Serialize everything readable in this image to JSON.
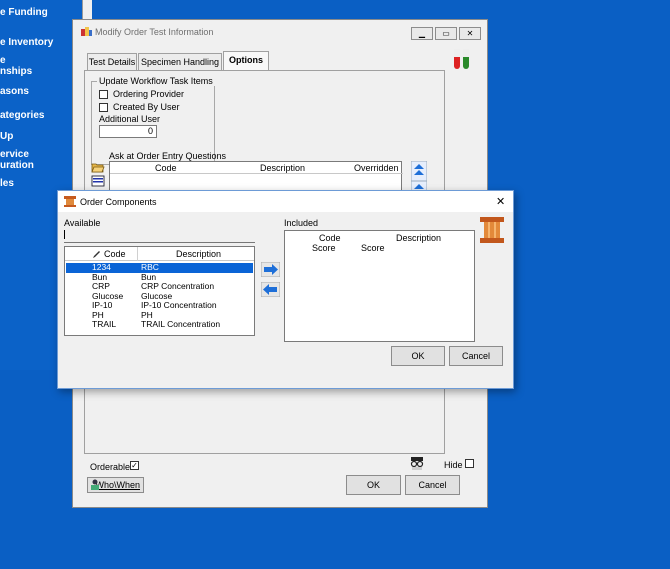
{
  "sidebar": {
    "items": [
      "e Funding",
      "e Inventory",
      "e",
      "nships",
      "asons",
      "ategories",
      "Up",
      "ervice",
      "uration",
      "les"
    ]
  },
  "main_window": {
    "title": "Modify Order Test Information",
    "tabs": [
      "Test Details",
      "Specimen Handling",
      "Options"
    ],
    "workflow_group_title": "Update Workflow Task Items",
    "ordering_provider_label": "Ordering Provider",
    "created_by_user_label": "Created By User",
    "additional_user_label": "Additional User",
    "additional_user_value": "0",
    "aoe_label": "Ask at Order Entry Questions",
    "aoe_columns": [
      "Code",
      "Description",
      "Overridden"
    ],
    "orderable_label": "Orderable",
    "orderable_checked": true,
    "who_when_label": "Who\\When",
    "hide_label": "Hide",
    "ok_label": "OK",
    "cancel_label": "Cancel"
  },
  "dialog": {
    "title": "Order Components",
    "close_glyph": "✕",
    "available_label": "Available",
    "search_value": "",
    "included_label": "Included",
    "available_columns": [
      "Code",
      "Description"
    ],
    "available_rows": [
      {
        "code": "1234",
        "desc": "RBC"
      },
      {
        "code": "Bun",
        "desc": "Bun"
      },
      {
        "code": "CRP",
        "desc": "CRP Concentration"
      },
      {
        "code": "Glucose",
        "desc": "Glucose"
      },
      {
        "code": "IP-10",
        "desc": "IP-10 Concentration"
      },
      {
        "code": "PH",
        "desc": "PH"
      },
      {
        "code": "TRAIL",
        "desc": "TRAIL Concentration"
      }
    ],
    "selected_row": 0,
    "included_columns": [
      "Code",
      "Description"
    ],
    "included_rows": [
      {
        "code": "Score",
        "desc": "Score"
      }
    ],
    "ok_label": "OK",
    "cancel_label": "Cancel"
  },
  "colors": {
    "desktop": "#0a5fc4",
    "selection": "#0a64d6",
    "arrow": "#1e6fd8"
  }
}
